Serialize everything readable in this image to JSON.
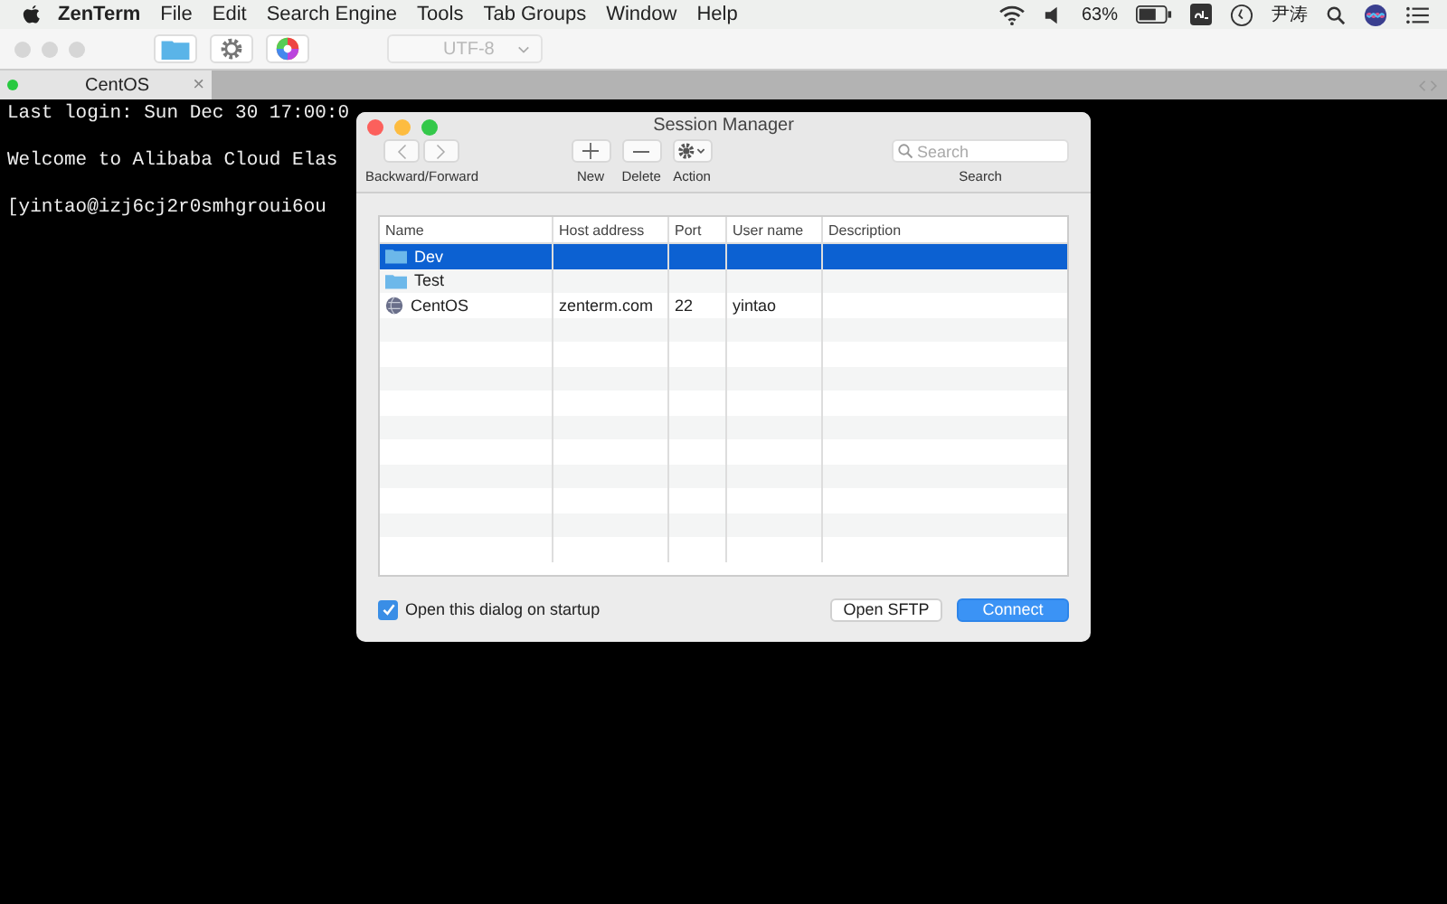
{
  "menu_bar": {
    "app": "ZenTerm",
    "items": [
      "File",
      "Edit",
      "Search Engine",
      "Tools",
      "Tab Groups",
      "Window",
      "Help"
    ],
    "battery": "63%",
    "user": "尹涛"
  },
  "toolbar": {
    "encoding": "UTF-8",
    "encoding_disabled": true
  },
  "tabs": [
    {
      "label": "CentOS",
      "close": "×",
      "selected": true
    }
  ],
  "terminal": {
    "lines": [
      "Last login: Sun Dec 30 17:00:0",
      "Welcome to Alibaba Cloud Elas",
      "[yintao@izj6cj2r0smhgroui6ou"
    ]
  },
  "dialog": {
    "title": "Session Manager",
    "toolbar": {
      "nav_label": "Backward/Forward",
      "new_label": "New",
      "delete_label": "Delete",
      "action_label": "Action",
      "search_placeholder": "Search",
      "search_label": "Search"
    },
    "columns": [
      "Name",
      "Host address",
      "Port",
      "User name",
      "Description"
    ],
    "rows": [
      {
        "kind": "folder",
        "name": "Dev",
        "host": "",
        "port": "",
        "user": "",
        "selected": true
      },
      {
        "kind": "folder",
        "name": "Test",
        "host": "",
        "port": "",
        "user": "",
        "selected": false
      },
      {
        "kind": "server",
        "name": "CentOS",
        "host": "zenterm.com",
        "port": "22",
        "user": "yintao",
        "selected": false
      }
    ],
    "startup": {
      "label": "Open this dialog on startup",
      "checked": true
    },
    "buttons": [
      "Open SFTP",
      "Connect"
    ]
  }
}
